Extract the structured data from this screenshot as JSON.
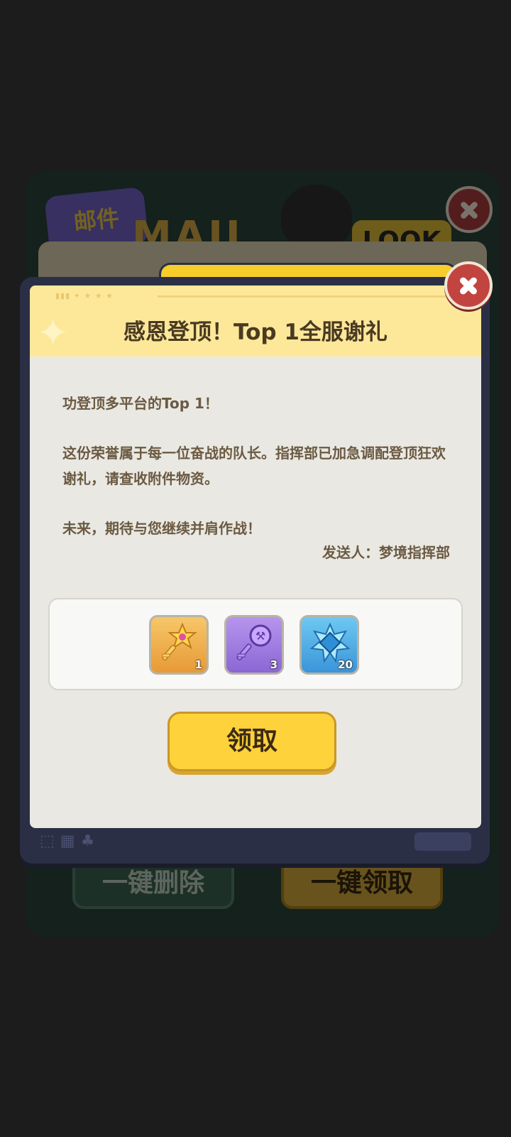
{
  "background_mail": {
    "tab_label": "邮件",
    "title_art": "MAIL",
    "look_tag": "LOOK",
    "delete_all_label": "一键删除",
    "claim_all_label": "一键领取"
  },
  "dialog": {
    "title": "感恩登顶！Top 1全服谢礼",
    "paragraph1": "功登顶多平台的Top 1！",
    "paragraph2": "这份荣誉属于每一位奋战的队长。指挥部已加急调配登顶狂欢谢礼，请查收附件物资。",
    "paragraph3": "未来，期待与您继续并肩作战！",
    "sender": "发送人：梦境指挥部",
    "claim_label": "领取"
  },
  "rewards": [
    {
      "icon": "star-key-icon",
      "qty": "1"
    },
    {
      "icon": "purple-key-icon",
      "qty": "3"
    },
    {
      "icon": "blue-crystal-icon",
      "qty": "20"
    }
  ],
  "colors": {
    "accent_yellow": "#fdd23a",
    "close_red": "#c2443f",
    "frame_navy": "#2b2f45",
    "text_brown": "#6b5a42"
  }
}
